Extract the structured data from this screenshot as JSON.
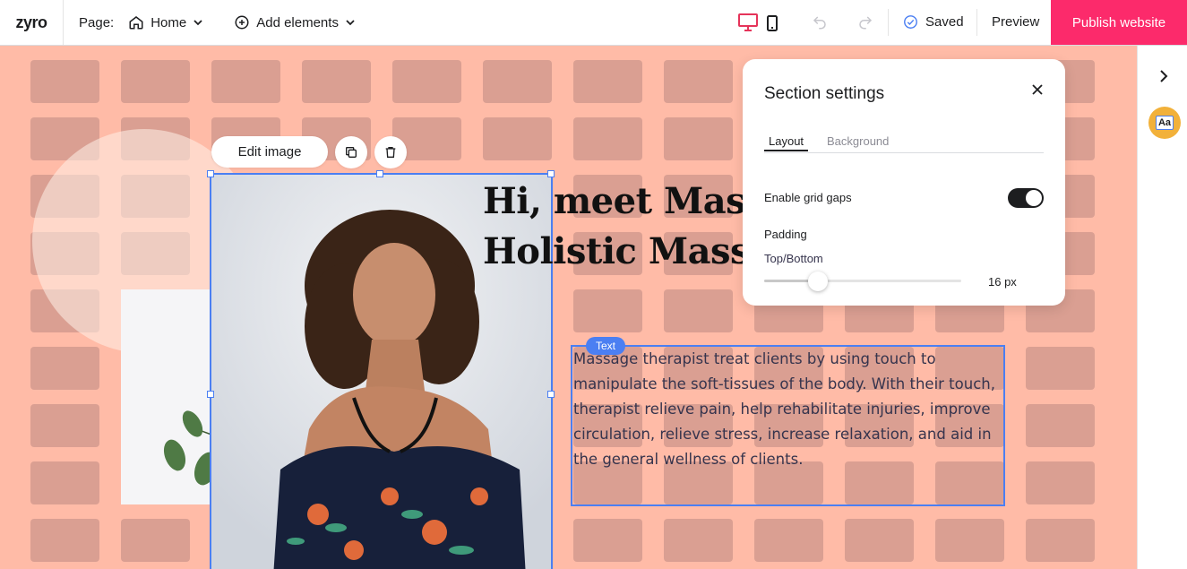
{
  "app": {
    "logo": "zyro"
  },
  "topbar": {
    "page_label": "Page:",
    "current_page": "Home",
    "add_elements": "Add elements",
    "saved": "Saved",
    "preview": "Preview",
    "publish": "Publish website"
  },
  "colors": {
    "accent": "#fc2a6b",
    "selection": "#4b7ff2",
    "canvas_bg": "#ffbba7",
    "device_active": "#e5345a"
  },
  "canvas": {
    "edit_image": "Edit image",
    "heading_line1": "Hi, meet Massy",
    "heading_line2": "Holistic Massa",
    "text_badge": "Text",
    "body_text": "Massage therapist treat clients by using touch to manipulate the soft-tissues of the body. With their touch, therapist relieve pain, help rehabilitate injuries, improve circulation, relieve stress, increase relaxation, and aid in the general wellness of clients."
  },
  "section_settings": {
    "title": "Section settings",
    "tabs": [
      {
        "label": "Layout",
        "active": true
      },
      {
        "label": "Background",
        "active": false
      }
    ],
    "enable_grid_gaps_label": "Enable grid gaps",
    "enable_grid_gaps": true,
    "padding_label": "Padding",
    "top_bottom_label": "Top/Bottom",
    "padding_value": "16 px"
  },
  "icons": {
    "home": "home-icon",
    "add": "plus-circle-icon",
    "desktop": "desktop-icon",
    "mobile": "mobile-icon",
    "undo": "undo-icon",
    "redo": "redo-icon",
    "saved": "check-circle-icon",
    "duplicate": "duplicate-icon",
    "delete": "trash-icon",
    "close": "close-icon",
    "sidebar_toggle": "chevron-right-icon",
    "typography": "typography-icon"
  }
}
